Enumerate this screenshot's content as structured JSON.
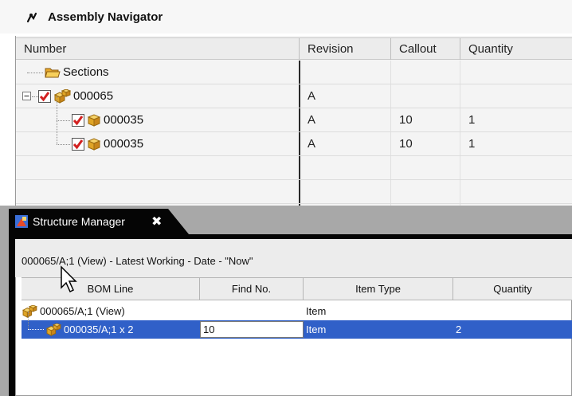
{
  "assembly_navigator": {
    "title": "Assembly Navigator",
    "columns": [
      "Number",
      "Revision",
      "Callout",
      "Quantity"
    ],
    "rows": [
      {
        "number": "Sections",
        "revision": "",
        "callout": "",
        "quantity": "",
        "icon": "folder-icon",
        "checked": false
      },
      {
        "number": "000065",
        "revision": "A",
        "callout": "",
        "quantity": "",
        "icon": "assembly-icon",
        "checked": true
      },
      {
        "number": "000035",
        "revision": "A",
        "callout": "10",
        "quantity": "1",
        "icon": "component-icon",
        "checked": true
      },
      {
        "number": "000035",
        "revision": "A",
        "callout": "10",
        "quantity": "1",
        "icon": "component-icon",
        "checked": true
      }
    ]
  },
  "structure_manager": {
    "tab_label": "Structure Manager",
    "close_glyph": "✖",
    "context_line": "000065/A;1 (View) - Latest Working - Date - \"Now\"",
    "columns": [
      "BOM Line",
      "Find No.",
      "Item Type",
      "Quantity"
    ],
    "rows": [
      {
        "bom_line": "000065/A;1 (View)",
        "find_no": "",
        "item_type": "Item",
        "quantity": ""
      },
      {
        "bom_line": "000035/A;1 x 2",
        "find_no": "10",
        "item_type": "Item",
        "quantity": "2"
      }
    ]
  },
  "colors": {
    "selection": "#3060c8",
    "tab_background": "#050505",
    "check_red": "#d22020"
  }
}
